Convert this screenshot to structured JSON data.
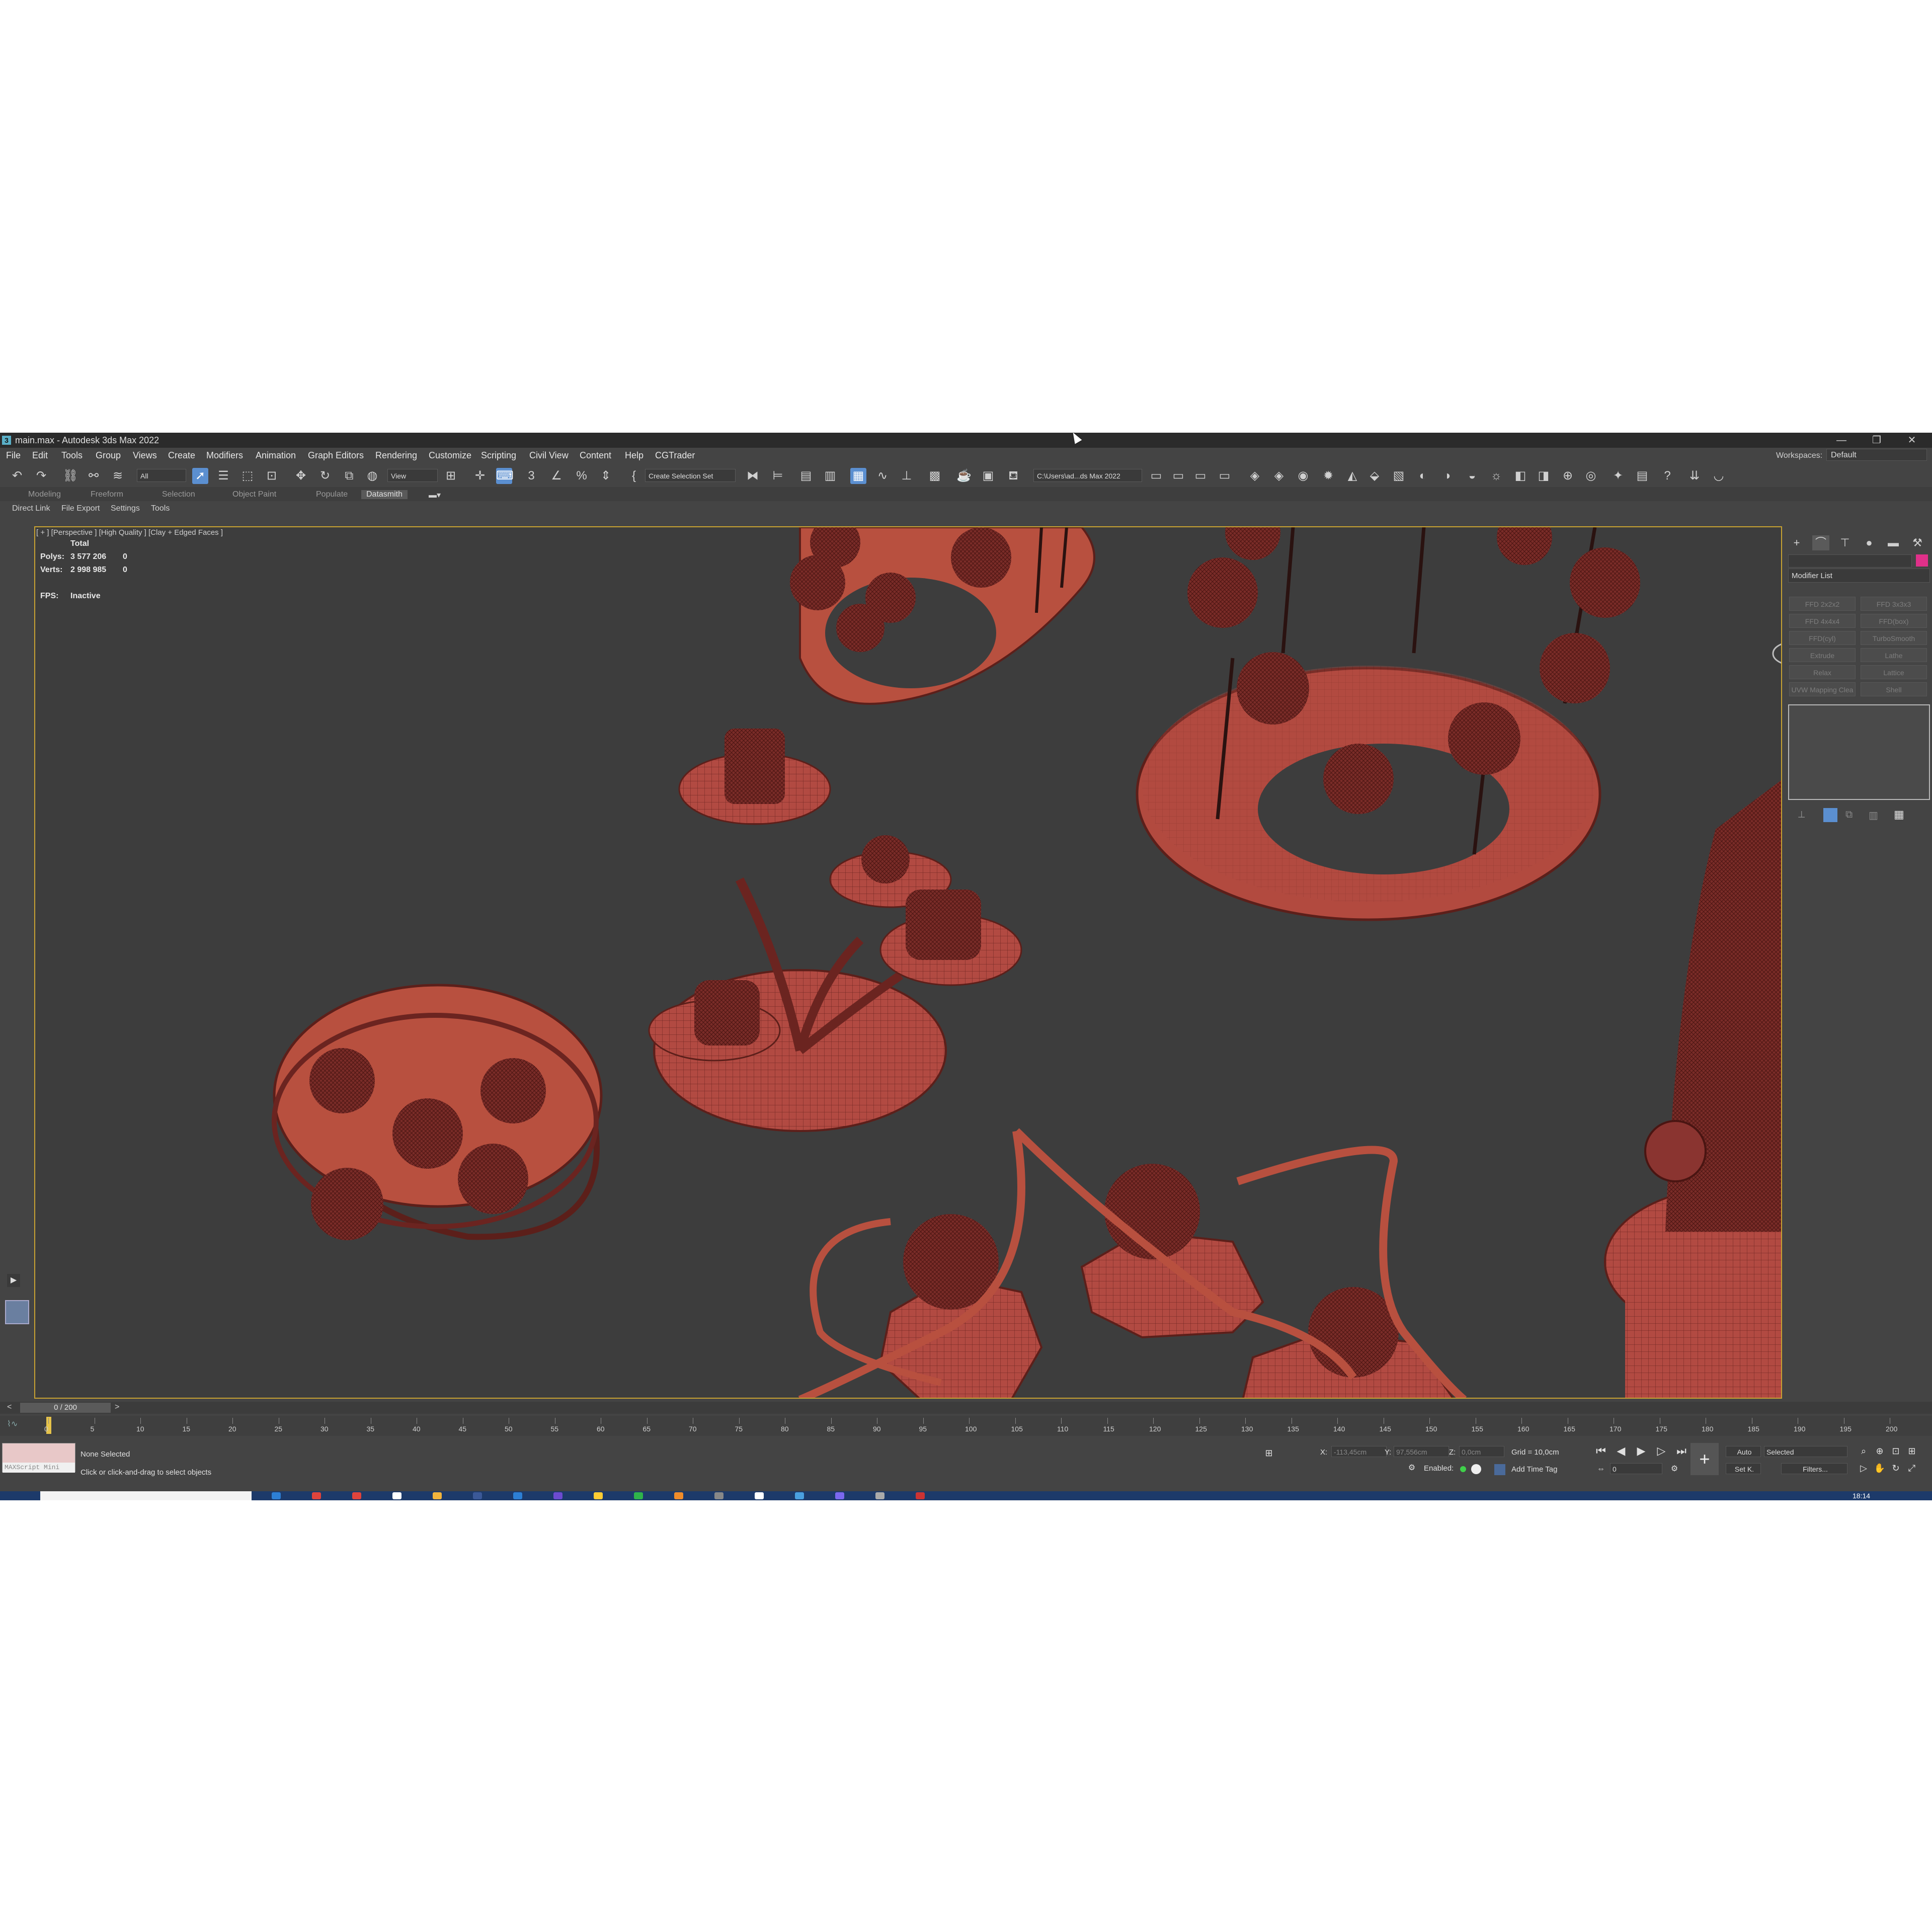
{
  "window": {
    "title": "main.max - Autodesk 3ds Max 2022",
    "controls": [
      "—",
      "❐",
      "✕"
    ]
  },
  "menu": [
    "File",
    "Edit",
    "Tools",
    "Group",
    "Views",
    "Create",
    "Modifiers",
    "Animation",
    "Graph Editors",
    "Rendering",
    "Customize",
    "Scripting",
    "Civil View",
    "Content",
    "Help",
    "CGTrader"
  ],
  "workspaces": {
    "label": "Workspaces:",
    "value": "Default"
  },
  "toolbar": {
    "filter_select": "All",
    "coord_select": "View",
    "selection_set": "Create Selection Set",
    "project_path": "C:\\Users\\ad...ds Max 2022"
  },
  "ribbon": {
    "tabs": [
      "Modeling",
      "Freeform",
      "Selection",
      "Object Paint",
      "Populate",
      "Datasmith"
    ],
    "subtabs": [
      "Direct Link",
      "File Export",
      "Settings",
      "Tools"
    ]
  },
  "viewport": {
    "label": "[ + ] [Perspective ] [High Quality ] [Clay + Edged Faces ]",
    "stats_header": "Total",
    "polys_label": "Polys:",
    "polys_value": "3 577 206",
    "polys_sel": "0",
    "verts_label": "Verts:",
    "verts_value": "2 998 985",
    "verts_sel": "0",
    "fps_label": "FPS:",
    "fps_value": "Inactive"
  },
  "command_panel": {
    "modifier_list": "Modifier List",
    "modifiers": [
      "FFD 2x2x2",
      "FFD 3x3x3",
      "FFD 4x4x4",
      "FFD(box)",
      "FFD(cyl)",
      "TurboSmooth",
      "Extrude",
      "Lathe",
      "Relax",
      "Lattice",
      "UVW Mapping Clea",
      "Shell"
    ],
    "accent_color": "#e0308a"
  },
  "timeline": {
    "slider": "0 / 200",
    "ticks": [
      "0",
      "5",
      "10",
      "15",
      "20",
      "25",
      "30",
      "35",
      "40",
      "45",
      "50",
      "55",
      "60",
      "65",
      "70",
      "75",
      "80",
      "85",
      "90",
      "95",
      "100",
      "105",
      "110",
      "115",
      "120",
      "125",
      "130",
      "135",
      "140",
      "145",
      "150",
      "155",
      "160",
      "165",
      "170",
      "175",
      "180",
      "185",
      "190",
      "195",
      "200"
    ]
  },
  "status": {
    "maxscript": "MAXScript Mini",
    "selection": "None Selected",
    "prompt": "Click or click-and-drag to select objects",
    "x_label": "X:",
    "x_value": "-113,45cm",
    "y_label": "Y:",
    "y_value": "97,556cm",
    "z_label": "Z:",
    "z_value": "0,0cm",
    "grid": "Grid = 10,0cm",
    "enabled": "Enabled:",
    "add_time_tag": "Add Time Tag",
    "auto": "Auto",
    "selected": "Selected",
    "set_key": "Set K.",
    "filters": "Filters...",
    "frame": "0"
  },
  "taskbar": {
    "clock": "18:14"
  }
}
